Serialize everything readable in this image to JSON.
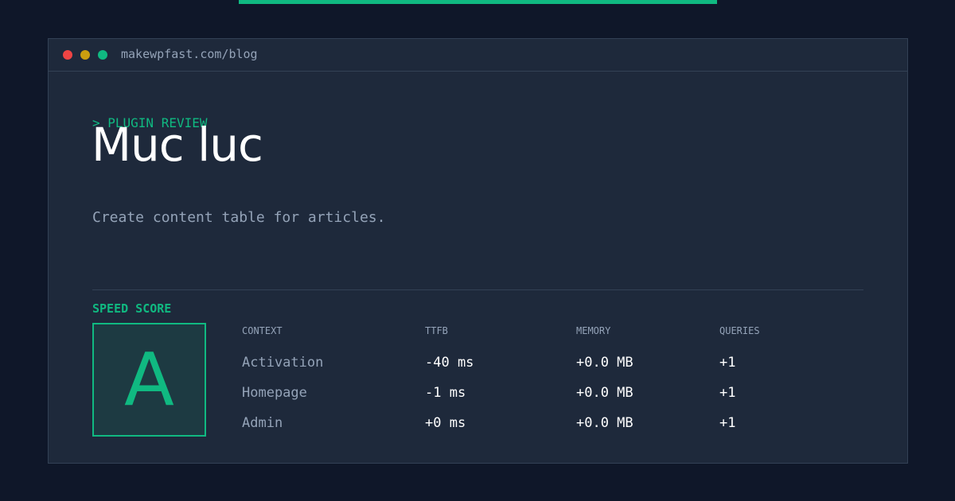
{
  "colors": {
    "background": "#0f1729",
    "panel": "#1e293b",
    "accent": "#10b981",
    "muted": "#94a3b8",
    "close_dot": "#ef4444",
    "minimize_dot": "#eab308",
    "maximize_dot": "#10b981"
  },
  "window": {
    "url": "makewpfast.com/blog"
  },
  "hero": {
    "eyebrow": "> PLUGIN REVIEW",
    "title": "Muc luc",
    "description": "Create content table for articles."
  },
  "speed": {
    "label": "SPEED SCORE",
    "grade": "A"
  },
  "table": {
    "headers": {
      "context": "CONTEXT",
      "ttfb": "TTFB",
      "memory": "MEMORY",
      "queries": "QUERIES"
    },
    "rows": [
      {
        "context": "Activation",
        "ttfb": "-40 ms",
        "memory": "+0.0 MB",
        "queries": "+1"
      },
      {
        "context": "Homepage",
        "ttfb": "-1 ms",
        "memory": "+0.0 MB",
        "queries": "+1"
      },
      {
        "context": "Admin",
        "ttfb": "+0 ms",
        "memory": "+0.0 MB",
        "queries": "+1"
      }
    ]
  }
}
